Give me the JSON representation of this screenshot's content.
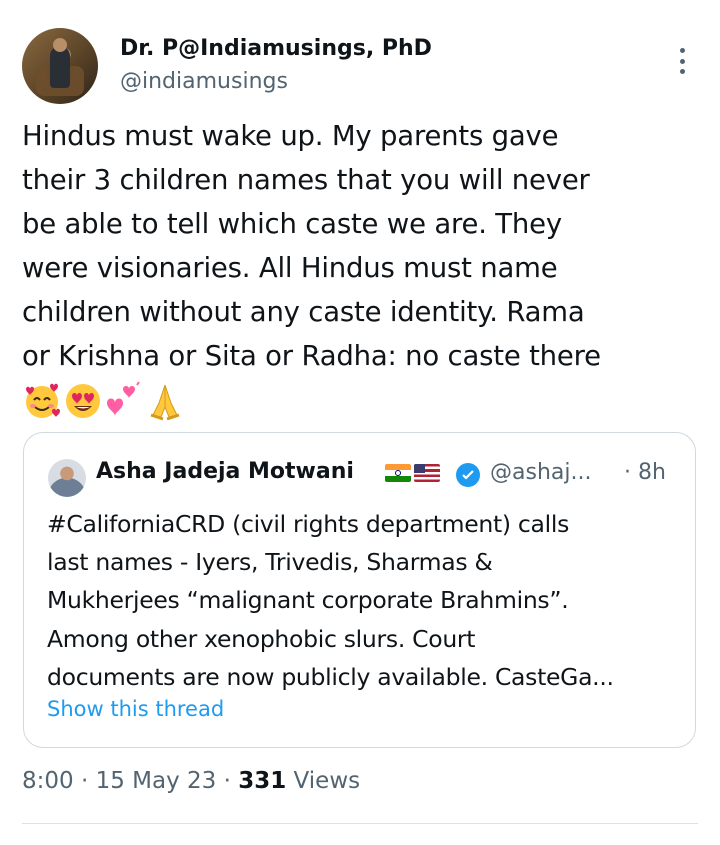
{
  "author": {
    "name": "Dr. P@Indiamusings, PhD",
    "handle": "@indiamusings"
  },
  "tweet": {
    "lines": [
      "Hindus must wake up. My parents gave",
      "their 3 children names that you will never",
      "be able to tell which caste we are. They",
      "were visionaries. All Hindus must name",
      "children without any caste identity. Rama",
      "or Krishna or Sita or Radha: no caste there"
    ],
    "emojis": [
      "smiling-face-with-hearts",
      "heart-eyes",
      "two-hearts",
      "folded-hands"
    ]
  },
  "quote": {
    "name": "Asha Jadeja Motwani",
    "flags": [
      "india-flag",
      "usa-flag"
    ],
    "handle": "@ashaj...",
    "time": "· 8h",
    "lines": [
      "#CaliforniaCRD (civil rights department) calls",
      "last names - Iyers, Trivedis, Sharmas  &",
      "Mukherjees “malignant corporate Brahmins”.",
      "Among other xenophobic slurs.  Court",
      "documents are now publicly available. CasteGa..."
    ],
    "show_thread": "Show this thread"
  },
  "meta": {
    "time": "8:00 · 15 May 23 · ",
    "views_count": "331",
    "views_label": " Views"
  },
  "colors": {
    "text": "#0f1419",
    "secondary": "#536471",
    "accent": "#1d9bf0",
    "border": "#cfd9de"
  }
}
